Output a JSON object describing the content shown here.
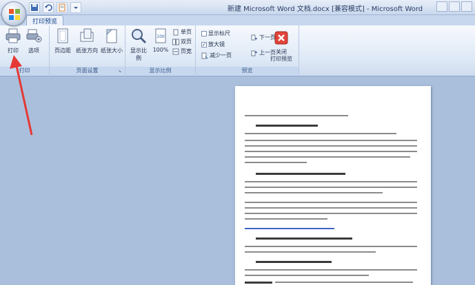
{
  "window": {
    "title": "新建 Microsoft Word 文档.docx [兼容模式] - Microsoft Word",
    "accent": "#15428b"
  },
  "tabs": [
    {
      "label": "打印预览",
      "active": true
    }
  ],
  "ribbon": {
    "print_group": {
      "label": "打印",
      "print": "打印",
      "options": "选项"
    },
    "page_setup_group": {
      "label": "页面设置",
      "margins": "页边距",
      "orientation": "纸张方向",
      "size": "纸张大小"
    },
    "zoom_group": {
      "label": "显示比例",
      "zoom": "显示比例",
      "percent": "100%",
      "one_page": "单页",
      "two_pages": "双页",
      "page_width": "页宽"
    },
    "preview_group": {
      "label": "预览",
      "show_ruler": "显示标尺",
      "magnifier": "放大镜",
      "shrink_one_page": "减少一页",
      "next_page": "下一页",
      "prev_page": "上一页",
      "close_preview": "关闭\n打印预览"
    }
  },
  "annotation": {
    "arrow_color": "#e53935"
  }
}
